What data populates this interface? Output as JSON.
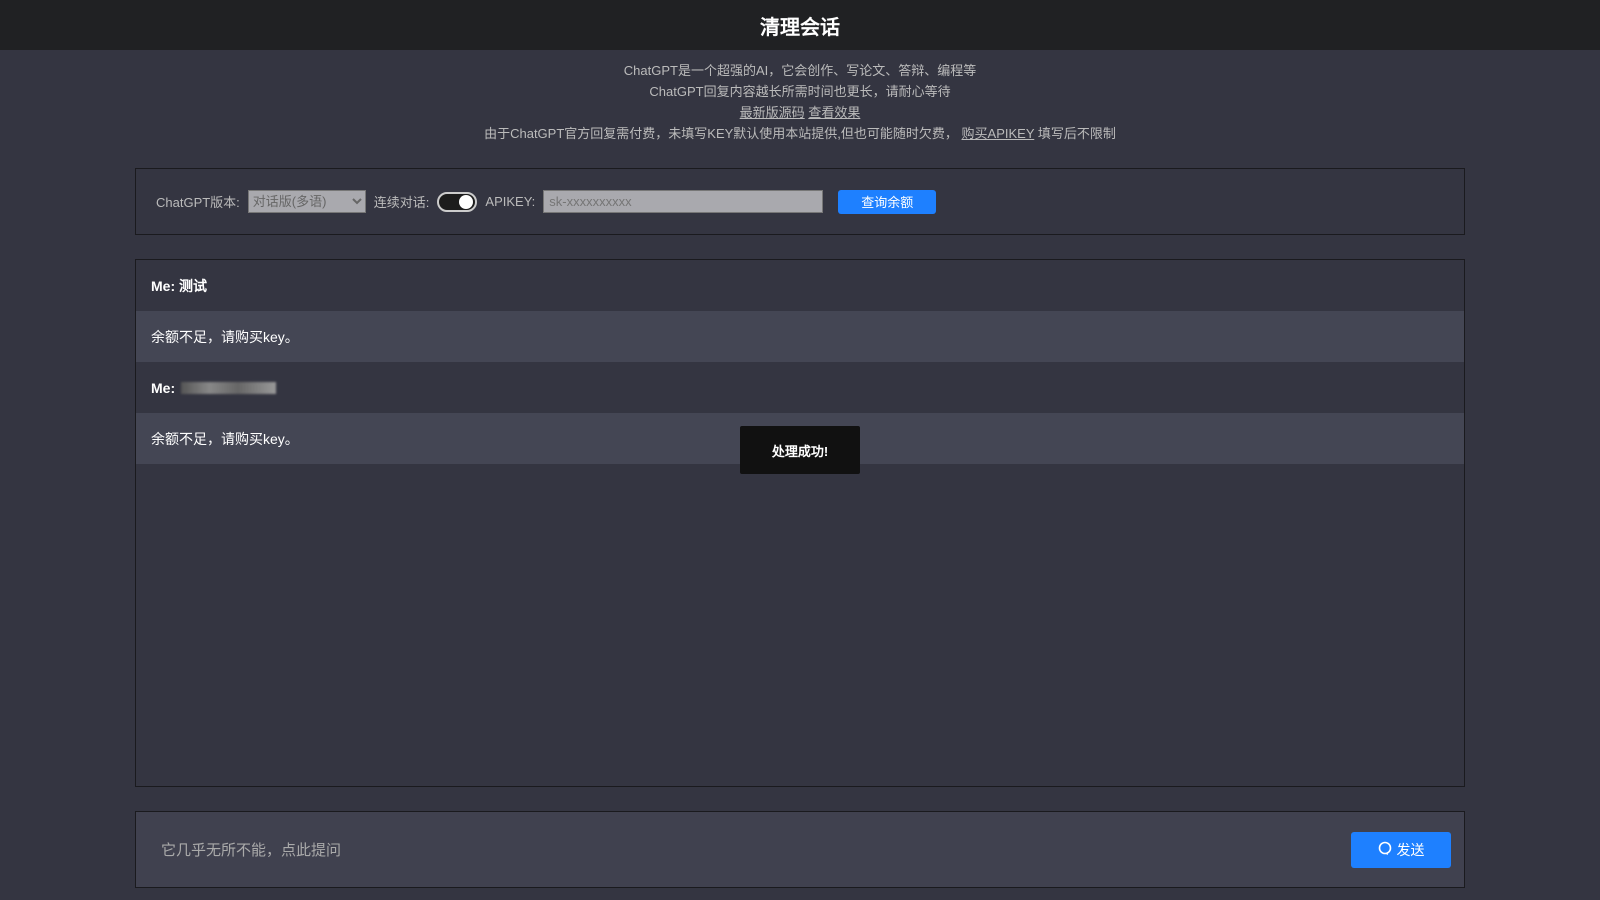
{
  "header": {
    "title": "清理会话"
  },
  "intro": {
    "line1": "ChatGPT是一个超强的AI，它会创作、写论文、答辩、编程等",
    "line2": "ChatGPT回复内容越长所需时间也更长，请耐心等待",
    "link_source": "最新版源码",
    "link_demo": "查看效果",
    "line4": "由于ChatGPT官方回复需付费，未填写KEY默认使用本站提供,但也可能随时欠费，",
    "link_buy": "购买APIKEY",
    "line4_tail": "填写后不限制"
  },
  "settings": {
    "version_label": "ChatGPT版本:",
    "version_value": "对话版(多语)",
    "continuous_label": "连续对话:",
    "continuous_on": true,
    "apikey_label": "APIKEY:",
    "apikey_placeholder": "sk-xxxxxxxxxx",
    "balance_button": "查询余额"
  },
  "messages": [
    {
      "role": "me",
      "prefix": "Me:",
      "text": "测试"
    },
    {
      "role": "ai",
      "text": "余额不足，请购买key。"
    },
    {
      "role": "me",
      "prefix": "Me:",
      "text": ""
    },
    {
      "role": "ai",
      "text": "余额不足，请购买key。"
    }
  ],
  "toast": "处理成功!",
  "input": {
    "placeholder": "它几乎无所不能，点此提问",
    "send_label": "发送"
  }
}
